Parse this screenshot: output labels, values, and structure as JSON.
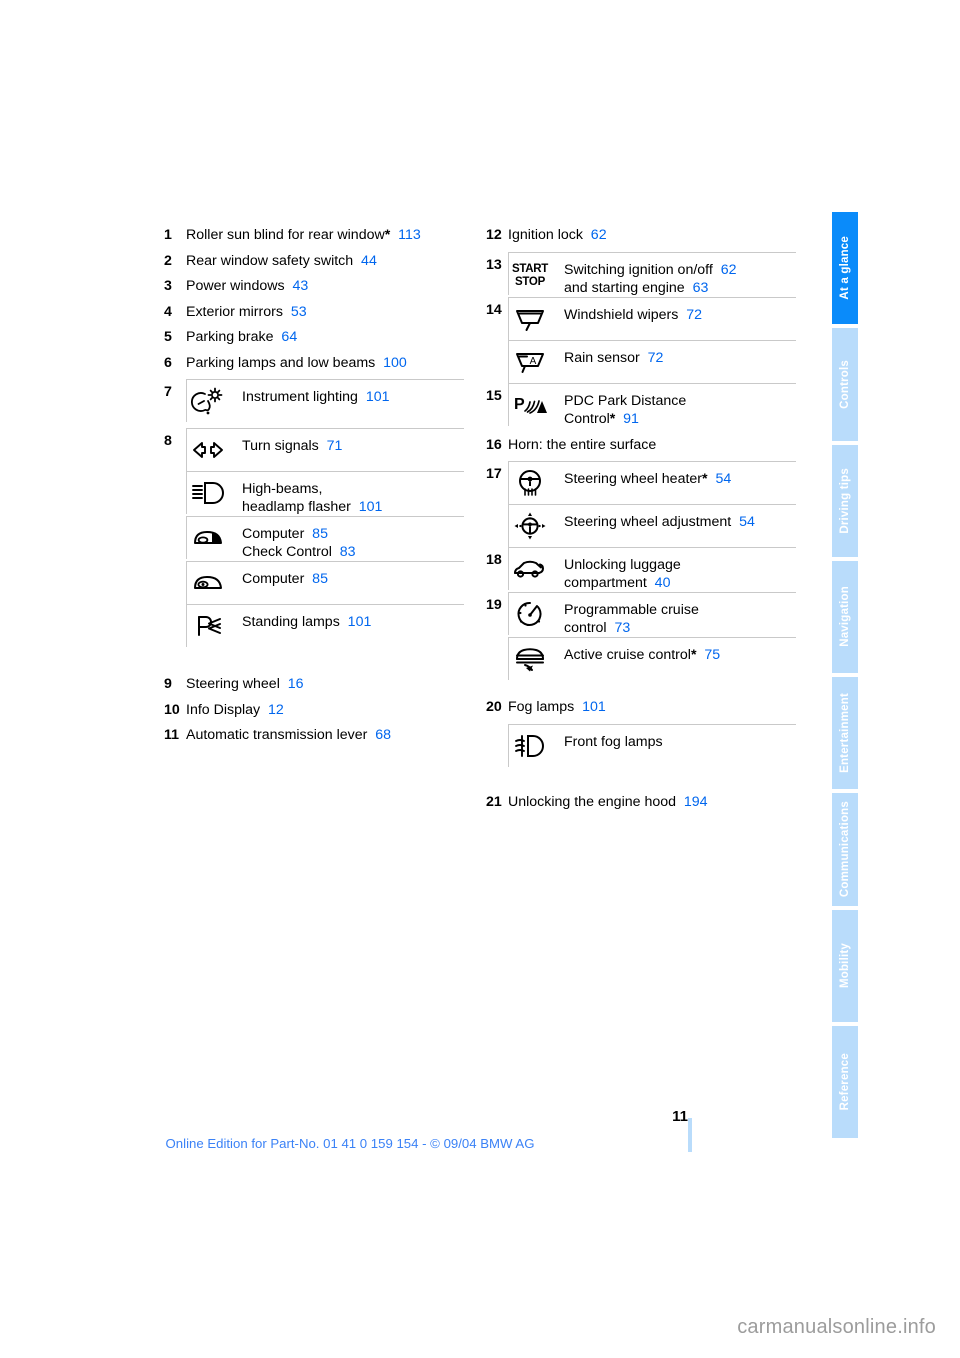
{
  "document": {
    "page_number": "11",
    "footer_note": "Online Edition for Part-No. 01 41 0 159 154 - © 09/04 BMW AG",
    "watermark": "carmanualsonline.info"
  },
  "tabs": [
    {
      "label": "At a glance",
      "active": true
    },
    {
      "label": "Controls",
      "active": false
    },
    {
      "label": "Driving tips",
      "active": false
    },
    {
      "label": "Navigation",
      "active": false
    },
    {
      "label": "Entertainment",
      "active": false
    },
    {
      "label": "Communications",
      "active": false
    },
    {
      "label": "Mobility",
      "active": false
    },
    {
      "label": "Reference",
      "active": false
    }
  ],
  "left_column": {
    "items": [
      {
        "num": "1",
        "label": "Roller sun blind for rear window",
        "star": "*",
        "page": "113"
      },
      {
        "num": "2",
        "label": "Rear window safety switch",
        "star": "",
        "page": "44"
      },
      {
        "num": "3",
        "label": "Power windows",
        "star": "",
        "page": "43"
      },
      {
        "num": "4",
        "label": "Exterior mirrors",
        "star": "",
        "page": "53"
      },
      {
        "num": "5",
        "label": "Parking brake",
        "star": "",
        "page": "64"
      },
      {
        "num": "6",
        "label": "Parking lamps and low beams",
        "star": "",
        "page": "100"
      }
    ],
    "group7": {
      "num": "7",
      "rows": [
        {
          "icon": "instrument-lighting-icon",
          "lines": [
            {
              "label": "Instrument lighting",
              "star": "",
              "page": "101"
            }
          ]
        }
      ]
    },
    "group8": {
      "num": "8",
      "rows": [
        {
          "icon": "turn-signals-icon",
          "lines": [
            {
              "label": "Turn signals",
              "star": "",
              "page": "71"
            }
          ]
        },
        {
          "icon": "high-beams-icon",
          "lines": [
            {
              "label": "High-beams,",
              "star": "",
              "page": ""
            },
            {
              "label": "headlamp flasher",
              "star": "",
              "page": "101"
            }
          ]
        },
        {
          "icon": "computer-check-icon",
          "lines": [
            {
              "label": "Computer",
              "star": "",
              "page": "85"
            },
            {
              "label": "Check Control",
              "star": "",
              "page": "83"
            }
          ]
        },
        {
          "icon": "computer-icon",
          "lines": [
            {
              "label": "Computer",
              "star": "",
              "page": "85"
            }
          ]
        },
        {
          "icon": "standing-lamps-icon",
          "lines": [
            {
              "label": "Standing lamps",
              "star": "",
              "page": "101"
            }
          ]
        }
      ]
    },
    "items_tail": [
      {
        "num": "9",
        "label": "Steering wheel",
        "star": "",
        "page": "16"
      },
      {
        "num": "10",
        "label": "Info Display",
        "star": "",
        "page": "12"
      },
      {
        "num": "11",
        "label": "Automatic transmission lever",
        "star": "",
        "page": "68"
      }
    ]
  },
  "right_column": {
    "item12": {
      "num": "12",
      "label": "Ignition lock",
      "star": "",
      "page": "62"
    },
    "group13": {
      "num": "13",
      "rows": [
        {
          "icon": "start-stop-icon",
          "lines": [
            {
              "label": "Switching ignition on/off",
              "star": "",
              "page": "62"
            },
            {
              "label": "and starting engine",
              "star": "",
              "page": "63"
            }
          ]
        }
      ]
    },
    "group14": {
      "num": "14",
      "rows": [
        {
          "icon": "windshield-wiper-icon",
          "lines": [
            {
              "label": "Windshield wipers",
              "star": "",
              "page": "72"
            }
          ]
        },
        {
          "icon": "rain-sensor-icon",
          "lines": [
            {
              "label": "Rain sensor",
              "star": "",
              "page": "72"
            }
          ]
        }
      ]
    },
    "group15": {
      "num": "15",
      "rows": [
        {
          "icon": "pdc-icon",
          "lines": [
            {
              "label": "PDC Park Distance",
              "star": "",
              "page": ""
            },
            {
              "label": "Control",
              "star": "*",
              "page": "91"
            }
          ]
        }
      ]
    },
    "item16": {
      "num": "16",
      "label": "Horn: the entire surface",
      "star": "",
      "page": ""
    },
    "group17": {
      "num": "17",
      "rows": [
        {
          "icon": "steering-wheel-heater-icon",
          "lines": [
            {
              "label": "Steering wheel heater",
              "star": "*",
              "page": "54"
            }
          ]
        },
        {
          "icon": "steering-wheel-adjustment-icon",
          "lines": [
            {
              "label": "Steering wheel adjustment",
              "star": "",
              "page": "54"
            }
          ]
        }
      ]
    },
    "group18": {
      "num": "18",
      "rows": [
        {
          "icon": "trunk-unlock-icon",
          "lines": [
            {
              "label": "Unlocking luggage",
              "star": "",
              "page": ""
            },
            {
              "label": "compartment",
              "star": "",
              "page": "40"
            }
          ]
        }
      ]
    },
    "group19": {
      "num": "19",
      "rows": [
        {
          "icon": "cruise-control-icon",
          "lines": [
            {
              "label": "Programmable cruise",
              "star": "",
              "page": ""
            },
            {
              "label": "control",
              "star": "",
              "page": "73"
            }
          ]
        },
        {
          "icon": "active-cruise-control-icon",
          "lines": [
            {
              "label": "Active cruise control",
              "star": "*",
              "page": "75"
            }
          ]
        }
      ]
    },
    "item20": {
      "num": "20",
      "label": "Fog lamps",
      "star": "",
      "page": "101"
    },
    "group20": {
      "num": "",
      "rows": [
        {
          "icon": "front-fog-lamps-icon",
          "lines": [
            {
              "label": "Front fog lamps",
              "star": "",
              "page": ""
            }
          ]
        }
      ]
    },
    "item21": {
      "num": "21",
      "label": "Unlocking the engine hood",
      "star": "",
      "page": "194"
    }
  },
  "colors": {
    "page_ref_blue": "#0066ee",
    "tab_active": "#0a8bfa",
    "tab_inactive": "#b9dcfb",
    "footer_blue": "#3b82f6"
  }
}
